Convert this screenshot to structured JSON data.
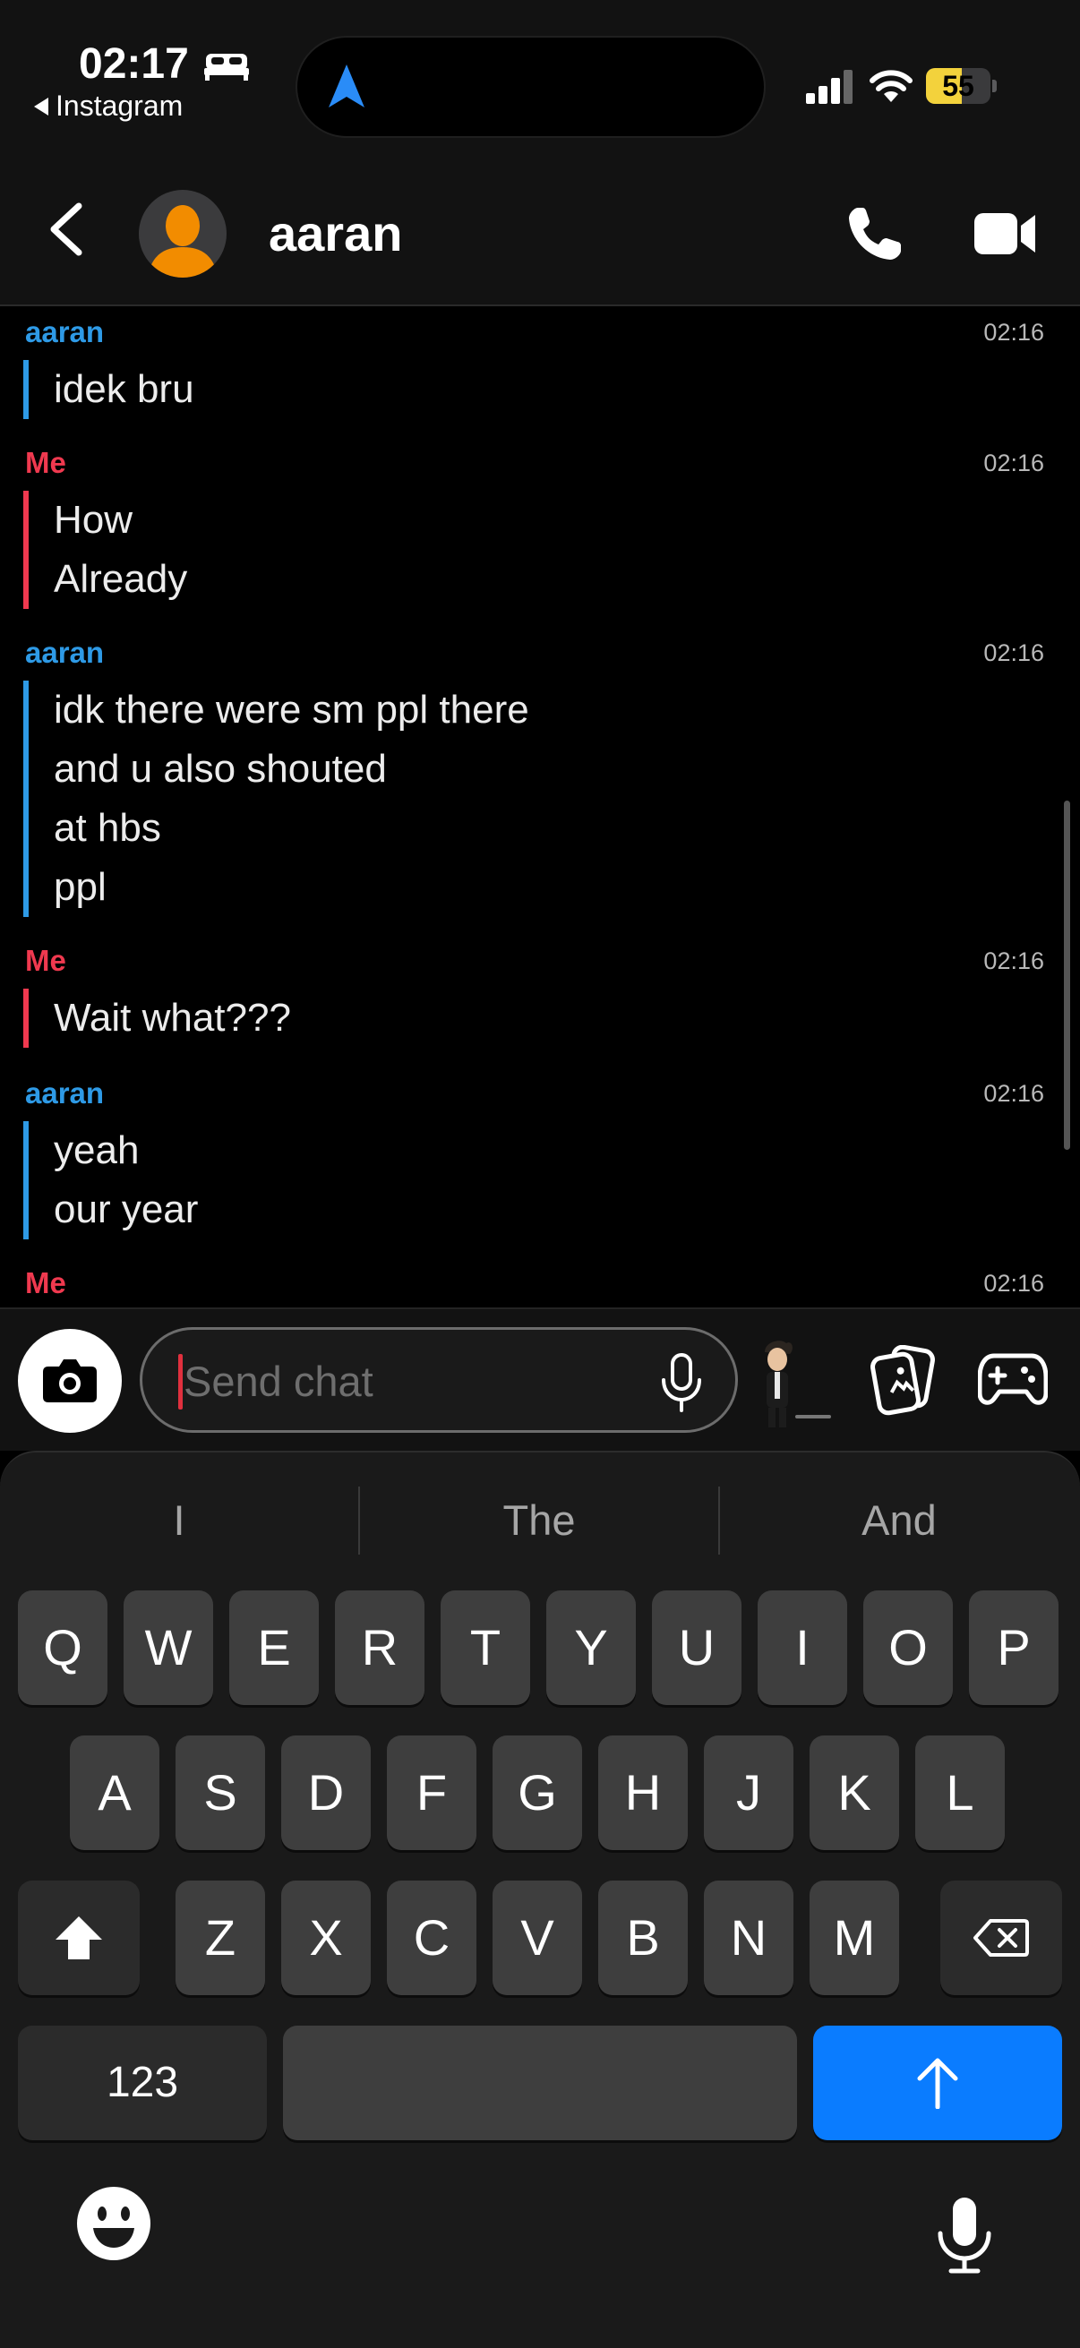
{
  "status_bar": {
    "time": "02:17",
    "back_app": "Instagram",
    "battery_percent": "55",
    "battery_level": 0.55,
    "icons": [
      "bed-icon",
      "location-arrow-icon",
      "signal-icon",
      "wifi-icon",
      "battery-charging-icon"
    ]
  },
  "header": {
    "contact_name": "aaran",
    "icons": [
      "back-chevron-icon",
      "avatar-silhouette-icon",
      "phone-icon",
      "video-camera-icon"
    ]
  },
  "messages": [
    {
      "sender": "aaran",
      "time": "02:16",
      "lines": [
        "idek bru"
      ]
    },
    {
      "sender": "Me",
      "time": "02:16",
      "lines": [
        "How",
        "Already"
      ]
    },
    {
      "sender": "aaran",
      "time": "02:16",
      "lines": [
        "idk there were sm ppl there",
        "and u also shouted",
        "at hbs",
        "ppl"
      ]
    },
    {
      "sender": "Me",
      "time": "02:16",
      "lines": [
        "Wait what???"
      ]
    },
    {
      "sender": "aaran",
      "time": "02:16",
      "lines": [
        "yeah",
        "our year"
      ]
    },
    {
      "sender": "Me",
      "time": "02:16",
      "lines": []
    }
  ],
  "composer": {
    "placeholder": "Send chat",
    "icons": [
      "camera-icon",
      "microphone-icon",
      "bitmoji-icon",
      "cards-icon",
      "game-controller-icon"
    ]
  },
  "keyboard": {
    "suggestions": [
      "I",
      "The",
      "And"
    ],
    "row1": [
      "Q",
      "W",
      "E",
      "R",
      "T",
      "Y",
      "U",
      "I",
      "O",
      "P"
    ],
    "row2": [
      "A",
      "S",
      "D",
      "F",
      "G",
      "H",
      "J",
      "K",
      "L"
    ],
    "row3": [
      "Z",
      "X",
      "C",
      "V",
      "B",
      "N",
      "M"
    ],
    "numbers_label": "123",
    "icons": [
      "shift-icon",
      "delete-icon",
      "send-arrow-icon",
      "emoji-icon",
      "dictation-icon"
    ]
  },
  "colors": {
    "aaran": "#2e9ae6",
    "me": "#f0394f",
    "send_key": "#0a7cff",
    "battery": "#f3d23c"
  }
}
